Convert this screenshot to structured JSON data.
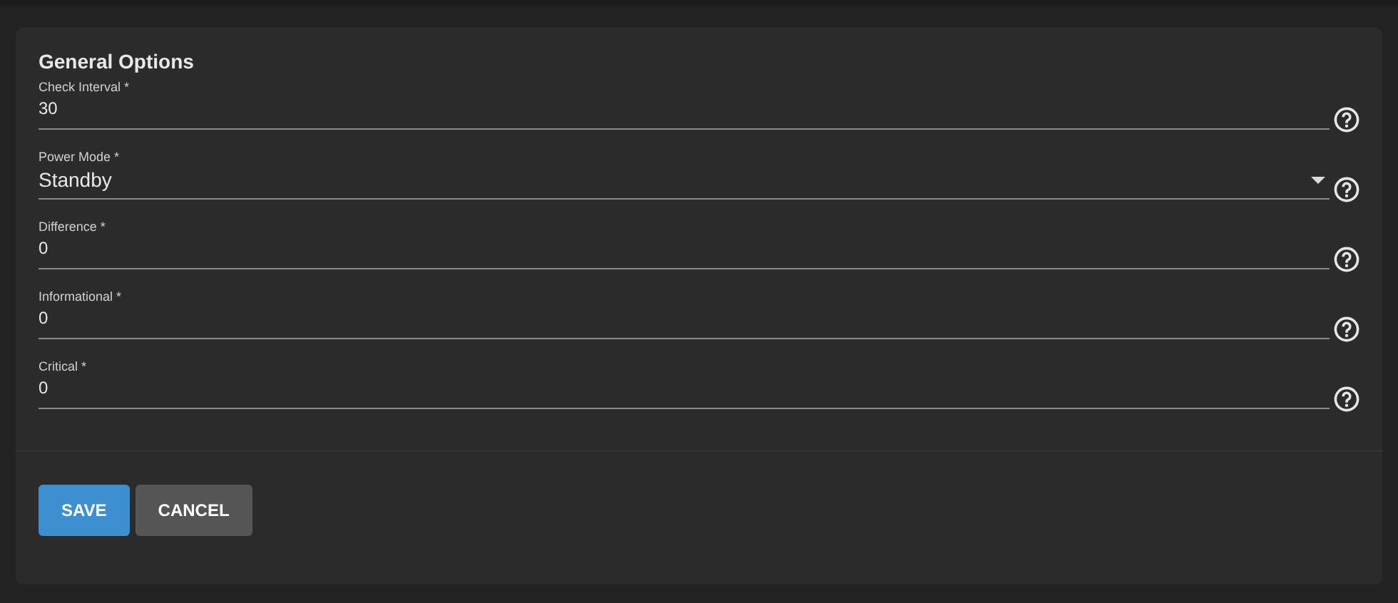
{
  "title": "General Options",
  "fields": [
    {
      "kind": "input",
      "label": "Check Interval *",
      "value": "30"
    },
    {
      "kind": "select",
      "label": "Power Mode *",
      "value": "Standby"
    },
    {
      "kind": "input",
      "label": "Difference *",
      "value": "0"
    },
    {
      "kind": "input",
      "label": "Informational *",
      "value": "0"
    },
    {
      "kind": "input",
      "label": "Critical *",
      "value": "0"
    }
  ],
  "buttons": [
    {
      "kind": "primary",
      "label": "SAVE"
    },
    {
      "kind": "secondary",
      "label": "CANCEL"
    }
  ]
}
